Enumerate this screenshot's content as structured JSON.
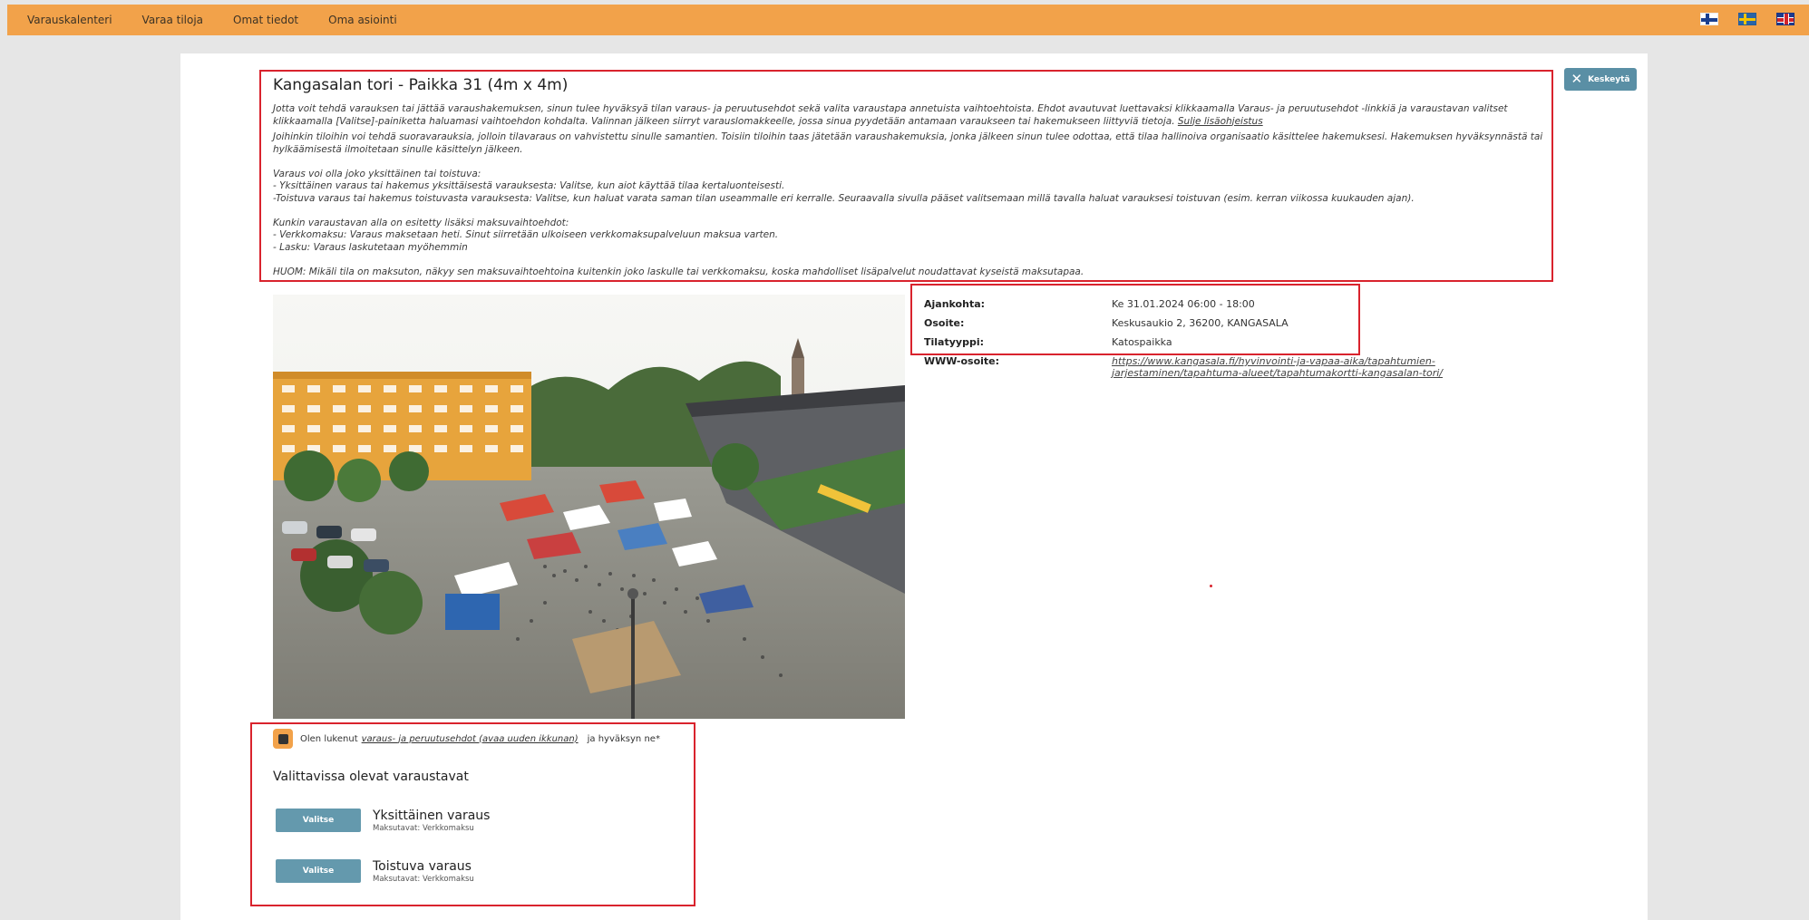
{
  "nav": {
    "items": [
      "Varauskalenteri",
      "Varaa tiloja",
      "Omat tiedot",
      "Oma asiointi"
    ],
    "languages": [
      "fi-flag-icon",
      "sv-flag-icon",
      "en-flag-icon"
    ]
  },
  "cancel_label": "Keskeytä",
  "title": "Kangasalan tori - Paikka 31 (4m x 4m)",
  "info": {
    "p1": "Jotta voit tehdä varauksen tai jättää varaushakemuksen, sinun tulee hyväksyä tilan varaus- ja peruutusehdot sekä valita varaustapa annetuista vaihtoehtoista. Ehdot avautuvat luettavaksi klikkaamalla Varaus- ja peruutusehdot -linkkiä ja varaustavan valitset klikkaamalla [Valitse]-painiketta haluamasi vaihtoehdon kohdalta. Valinnan jälkeen siirryt varauslomakkeelle, jossa sinua pyydetään antamaan varaukseen tai hakemukseen liittyviä tietoja.",
    "hide_link": "Sulje lisäohjeistus",
    "p2": "Joihinkin tiloihin voi tehdä suoravarauksia, jolloin tilavaraus on vahvistettu sinulle samantien. Toisiin tiloihin taas jätetään varaushakemuksia, jonka jälkeen sinun tulee odottaa, että tilaa hallinoiva organisaatio käsittelee hakemuksesi. Hakemuksen hyväksynnästä tai hylkäämisestä ilmoitetaan sinulle käsittelyn jälkeen.",
    "p3a": "Varaus voi olla joko yksittäinen tai toistuva:",
    "p3b": "- Yksittäinen varaus tai hakemus yksittäisestä varauksesta: Valitse, kun aiot käyttää tilaa kertaluonteisesti.",
    "p3c": "-Toistuva varaus tai hakemus toistuvasta varauksesta: Valitse, kun haluat varata saman tilan useammalle eri kerralle. Seuraavalla sivulla pääset valitsemaan millä tavalla haluat varauksesi toistuvan (esim. kerran viikossa kuukauden ajan).",
    "p4a": "Kunkin varaustavan alla on esitetty lisäksi maksuvaihtoehdot:",
    "p4b": "- Verkkomaksu: Varaus maksetaan heti. Sinut siirretään ulkoiseen verkkomaksupalveluun maksua varten.",
    "p4c": "- Lasku: Varaus laskutetaan myöhemmin",
    "p5": "HUOM: Mikäli tila on maksuton, näkyy sen maksuvaihtoehtoina kuitenkin joko laskulle tai verkkomaksu, koska mahdolliset lisäpalvelut noudattavat kyseistä maksutapaa."
  },
  "details": {
    "time_label": "Ajankohta:",
    "time_value": "Ke 31.01.2024 06:00 - 18:00",
    "address_label": "Osoite:",
    "address_value": "Keskusaukio 2, 36200, KANGASALA",
    "type_label": "Tilatyyppi:",
    "type_value": "Katospaikka",
    "www_label": "WWW-osoite:",
    "www_value": "https://www.kangasala.fi/hyvinvointi-ja-vapaa-aika/tapahtumien-jarjestaminen/tapahtuma-alueet/tapahtumakortti-kangasalan-tori/"
  },
  "terms": {
    "prefix": "Olen lukenut",
    "link": "varaus- ja peruutusehdot (avaa uuden ikkunan)",
    "suffix": "ja hyväksyn ne*"
  },
  "options_title": "Valittavissa olevat varaustavat",
  "options": [
    {
      "button": "Valitse",
      "title": "Yksittäinen varaus",
      "payment": "Maksutavat: Verkkomaksu"
    },
    {
      "button": "Valitse",
      "title": "Toistuva varaus",
      "payment": "Maksutavat: Verkkomaksu"
    }
  ],
  "colors": {
    "topbar": "#f2a24a",
    "highlight_border": "#d9232d",
    "button": "#6499ad"
  }
}
